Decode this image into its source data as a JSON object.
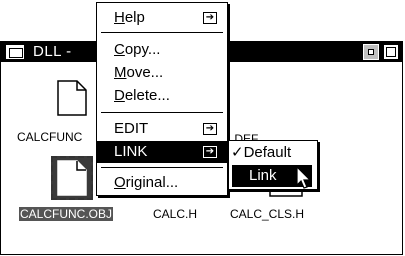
{
  "window": {
    "title": "DLL -",
    "files": [
      {
        "name": "CALCFUNC",
        "selected": false
      },
      {
        "name": "CALCFUNC.OBJ",
        "selected": true
      },
      {
        "name": "CALC.H",
        "selected": false
      },
      {
        "name": "CALC_CLS.H",
        "selected": false
      },
      {
        "name": ".DEF",
        "selected": false
      }
    ]
  },
  "context_menu": {
    "items": [
      {
        "prefix": "",
        "underline": "H",
        "rest": "elp",
        "submenu": true
      },
      {
        "prefix": "",
        "underline": "C",
        "rest": "opy...",
        "submenu": false
      },
      {
        "prefix": "",
        "underline": "M",
        "rest": "ove...",
        "submenu": false
      },
      {
        "prefix": "",
        "underline": "D",
        "rest": "elete...",
        "submenu": false
      },
      {
        "prefix": "",
        "underline": "",
        "rest": "EDIT",
        "submenu": true
      },
      {
        "prefix": "",
        "underline": "",
        "rest": "LINK",
        "submenu": true,
        "highlighted": true
      },
      {
        "prefix": "",
        "underline": "O",
        "rest": "riginal...",
        "submenu": false
      }
    ]
  },
  "submenu": {
    "items": [
      {
        "check": "✓",
        "label": "Default"
      },
      {
        "check": "",
        "label": "Link",
        "highlighted": true
      }
    ]
  },
  "icons": {
    "window_icon": "window-menu-icon",
    "submenu_arrow": "submenu-arrow-icon",
    "cursor": "mouse-pointer-icon"
  }
}
